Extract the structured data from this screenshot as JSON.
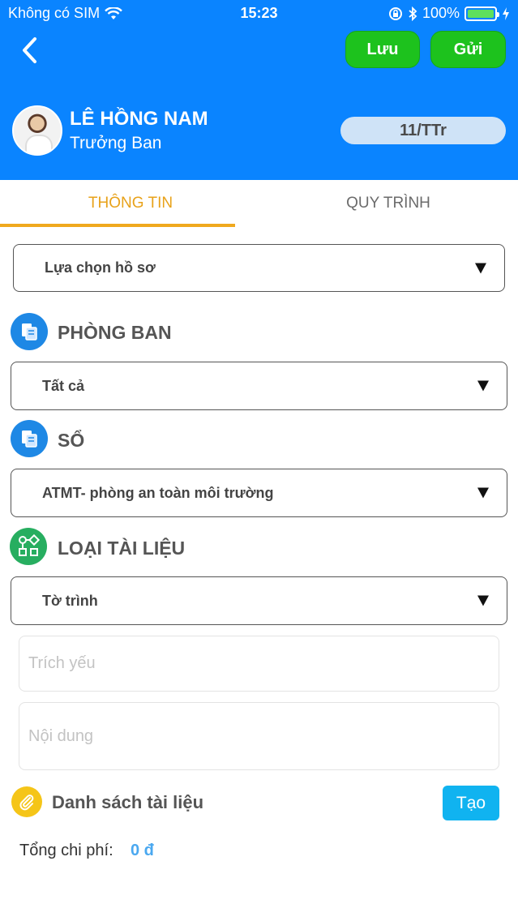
{
  "status_bar": {
    "carrier": "Không có SIM",
    "time": "15:23",
    "battery": "100%"
  },
  "header": {
    "save_label": "Lưu",
    "send_label": "Gửi",
    "user_name": "LÊ HỒNG NAM",
    "user_role": "Trưởng Ban",
    "doc_code": "11/TTr"
  },
  "tabs": [
    {
      "label": "THÔNG TIN",
      "active": true
    },
    {
      "label": "QUY TRÌNH",
      "active": false
    }
  ],
  "form": {
    "profile_select": "Lựa chọn hồ sơ",
    "department": {
      "title": "PHÒNG BAN",
      "value": "Tất cả"
    },
    "book": {
      "title": "SỔ",
      "value": "ATMT- phòng an toàn môi trường"
    },
    "doc_type": {
      "title": "LOẠI TÀI LIỆU",
      "value": "Tờ trình"
    },
    "summary_placeholder": "Trích yếu",
    "content_placeholder": "Nội dung"
  },
  "attachments": {
    "title": "Danh sách tài liệu",
    "create_label": "Tạo"
  },
  "total": {
    "label": "Tổng chi phí:",
    "value": "0 đ"
  },
  "colors": {
    "header_bg": "#0A84FF",
    "green_button": "#1DC21D",
    "tab_active": "#E8A21A",
    "create_button": "#10B3F0",
    "total_value": "#4AA8F0"
  },
  "icons": {
    "department": "department-icon",
    "book": "book-icon",
    "doc_type": "doc-type-icon",
    "attachments": "paperclip-icon"
  }
}
